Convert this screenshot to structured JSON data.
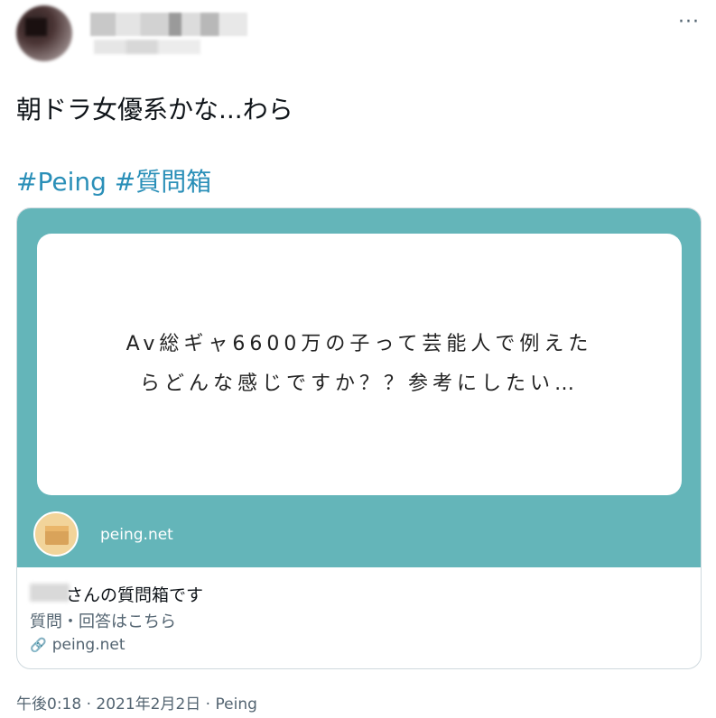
{
  "tweet": {
    "text": "朝ドラ女優系かな...わら",
    "hashtags": [
      "#Peing",
      "#質問箱"
    ],
    "more_icon": "more-horizontal-icon",
    "timestamp": "午後0:18 · 2021年2月2日 · Peing"
  },
  "card": {
    "image_domain": "peing.net",
    "question_line1": "Av総ギャ6600万の子って芸能人で例えた",
    "question_line2": "らどんな感じですか？？参考にしたい…",
    "title_suffix": "さんの質問箱です",
    "description": "質問・回答はこちら",
    "link_text": "peing.net",
    "link_icon": "link-icon",
    "image_bg": "#64b5b9"
  }
}
